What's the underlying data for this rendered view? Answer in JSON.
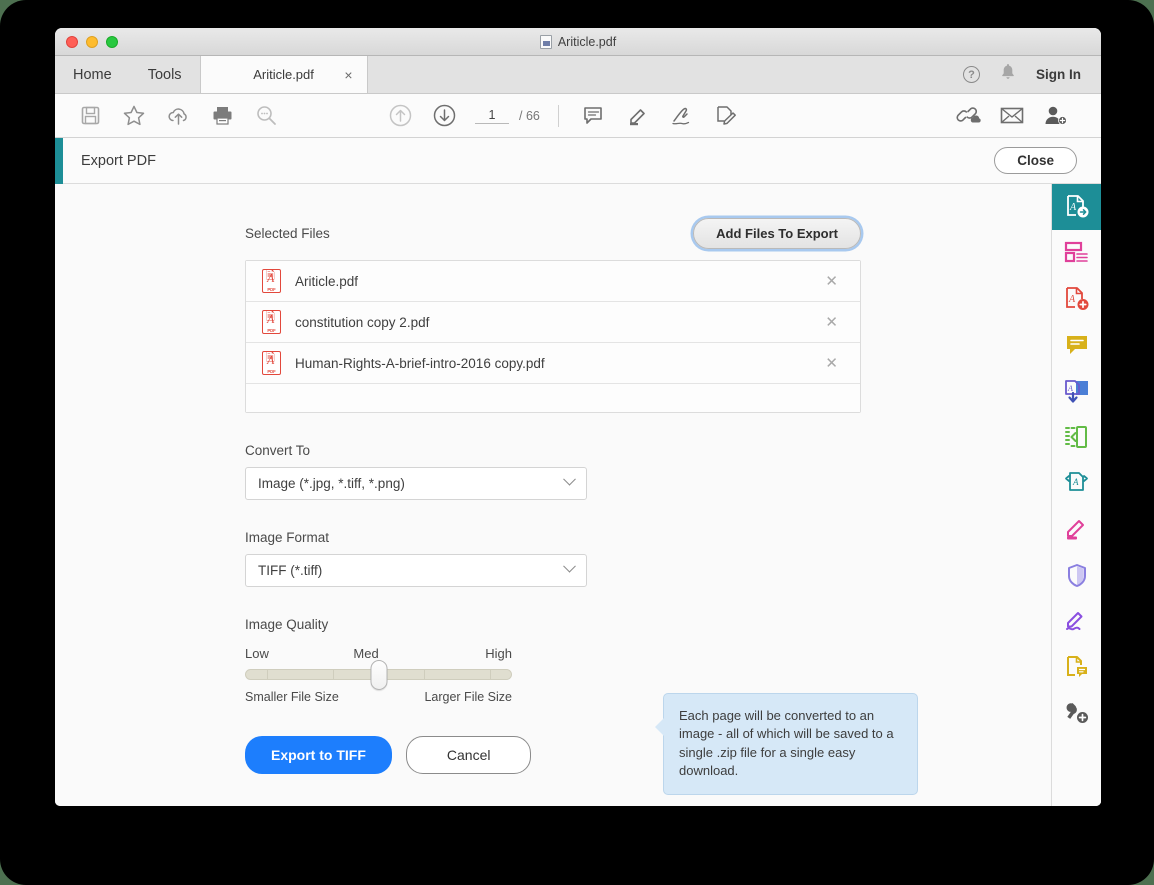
{
  "window": {
    "title": "Ariticle.pdf",
    "title_icon": "document-icon",
    "traffic_lights": [
      "close-red",
      "minimize-yellow",
      "maximize-green"
    ]
  },
  "menubar": {
    "items": [
      {
        "label": "Home",
        "name": "menu-home"
      },
      {
        "label": "Tools",
        "name": "menu-tools"
      }
    ],
    "document_tab": {
      "label": "Ariticle.pdf",
      "close": "×"
    },
    "right": {
      "help": "?",
      "bell_icon": "bell-icon",
      "sign_in": "Sign In"
    }
  },
  "toolbar": {
    "icons": [
      {
        "name": "save-icon",
        "glyph": "💾"
      },
      {
        "name": "star-icon",
        "glyph": "☆"
      },
      {
        "name": "cloud-upload-icon",
        "glyph": "☁"
      },
      {
        "name": "print-icon",
        "glyph": "⎙"
      },
      {
        "name": "zoom-search-icon",
        "glyph": "🔍"
      }
    ],
    "page_prev_icon": "arrow-up-circle-icon",
    "page_next_icon": "arrow-down-circle-icon",
    "page_current": "1",
    "page_total": "/ 66",
    "tools": [
      {
        "name": "comment-icon",
        "glyph": "💬"
      },
      {
        "name": "highlight-icon",
        "glyph": "✎"
      },
      {
        "name": "sign-icon",
        "glyph": "✍"
      },
      {
        "name": "edit-pdf-icon",
        "glyph": "🗎"
      }
    ],
    "right_tools": [
      {
        "name": "share-link-icon",
        "glyph": "🔗"
      },
      {
        "name": "email-icon",
        "glyph": "✉"
      },
      {
        "name": "add-person-icon",
        "glyph": "👤"
      }
    ]
  },
  "export_panel": {
    "title": "Export PDF",
    "close_label": "Close",
    "accent_color": "#1d8e97",
    "selected_files_label": "Selected Files",
    "add_files_label": "Add Files To Export",
    "files": [
      {
        "name": "Ariticle.pdf",
        "remove": "✕"
      },
      {
        "name": "constitution copy 2.pdf",
        "remove": "✕"
      },
      {
        "name": "Human-Rights-A-brief-intro-2016 copy.pdf",
        "remove": "✕"
      }
    ],
    "convert_to_label": "Convert To",
    "convert_to_value": "Image (*.jpg, *.tiff, *.png)",
    "image_format_label": "Image Format",
    "image_format_value": "TIFF (*.tiff)",
    "image_quality_label": "Image Quality",
    "quality_low": "Low",
    "quality_med": "Med",
    "quality_high": "High",
    "quality_position_percent": 50,
    "smaller_file_size": "Smaller File Size",
    "larger_file_size": "Larger File Size",
    "export_button": "Export to TIFF",
    "cancel_button": "Cancel",
    "tooltip": "Each page will be converted to an image - all of which will be saved to a single .zip file for a single easy download."
  },
  "right_rail": {
    "items": [
      {
        "name": "export-pdf-tool",
        "color": "#ffffff",
        "active": true
      },
      {
        "name": "organize-pages-tool",
        "color": "#e0409a",
        "active": false
      },
      {
        "name": "create-pdf-tool",
        "color": "#e2483c",
        "active": false
      },
      {
        "name": "comment-tool",
        "color": "#d8b11a",
        "active": false
      },
      {
        "name": "combine-files-tool",
        "color": "#6a5acd",
        "active": false
      },
      {
        "name": "crop-pages-tool",
        "color": "#62bb46",
        "active": false
      },
      {
        "name": "compress-pdf-tool",
        "color": "#1d8e97",
        "active": false
      },
      {
        "name": "edit-pdf-tool",
        "color": "#e0409a",
        "active": false
      },
      {
        "name": "protect-tool",
        "color": "#8a7fe0",
        "active": false
      },
      {
        "name": "fill-sign-tool",
        "color": "#8a4fe0",
        "active": false
      },
      {
        "name": "stamp-tool",
        "color": "#d8b11a",
        "active": false
      },
      {
        "name": "more-tools",
        "color": "#5a5a5a",
        "active": false
      }
    ]
  }
}
